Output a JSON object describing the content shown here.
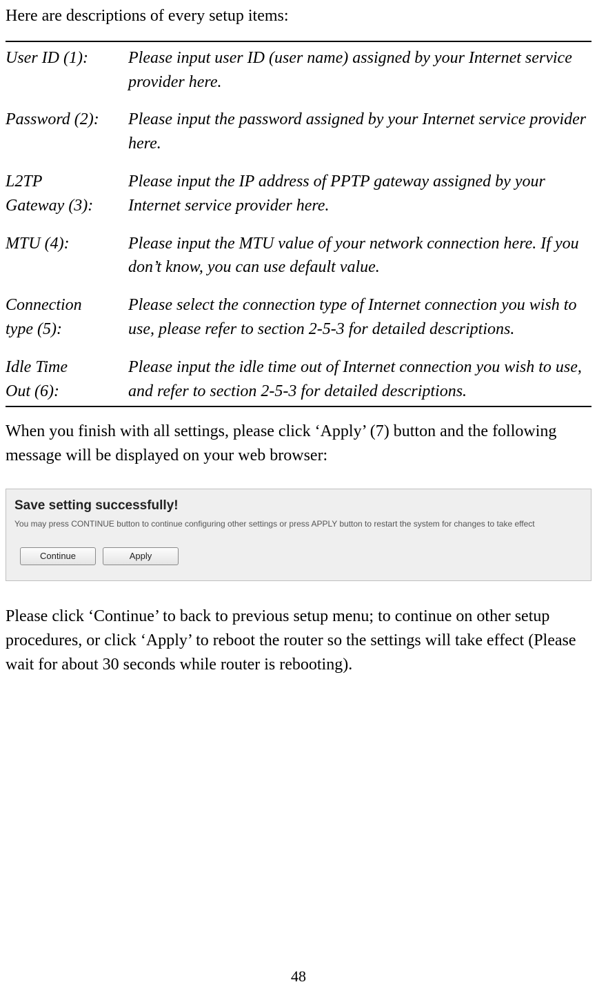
{
  "intro": "Here are descriptions of every setup items:",
  "rows": [
    {
      "term": "User ID (1):",
      "desc": "Please input user ID (user name) assigned by your Internet service provider here."
    },
    {
      "term": "Password (2):",
      "desc": "Please input the password assigned by your Internet service provider here."
    },
    {
      "term": "L2TP\nGateway (3):",
      "desc": "Please input the IP address of PPTP gateway assigned by your Internet service provider here."
    },
    {
      "term": "MTU (4):",
      "desc": "Please input the MTU value of your network connection here. If you don’t know, you can use default value."
    },
    {
      "term": "Connection\ntype (5):",
      "desc": "Please select the connection type of Internet connection you wish to use, please refer to section 2-5-3 for detailed descriptions."
    },
    {
      "term": "Idle Time\nOut (6):",
      "desc": "Please input the idle time out of Internet connection you wish to use, and refer to section 2-5-3 for detailed descriptions."
    }
  ],
  "para_after_table": "When you finish with all settings, please click ‘Apply’ (7) button and the following message will be displayed on your web browser:",
  "dialog": {
    "heading": "Save setting successfully!",
    "subtext": "You may press CONTINUE button to continue configuring other settings or press APPLY button to restart the system for changes to take effect",
    "continue_label": "Continue",
    "apply_label": "Apply"
  },
  "para_bottom": "Please click ‘Continue’ to back to previous setup menu; to continue on other setup procedures, or click ‘Apply’ to reboot the router so the settings will take effect (Please wait for about 30 seconds while router is rebooting).",
  "page_number": "48"
}
